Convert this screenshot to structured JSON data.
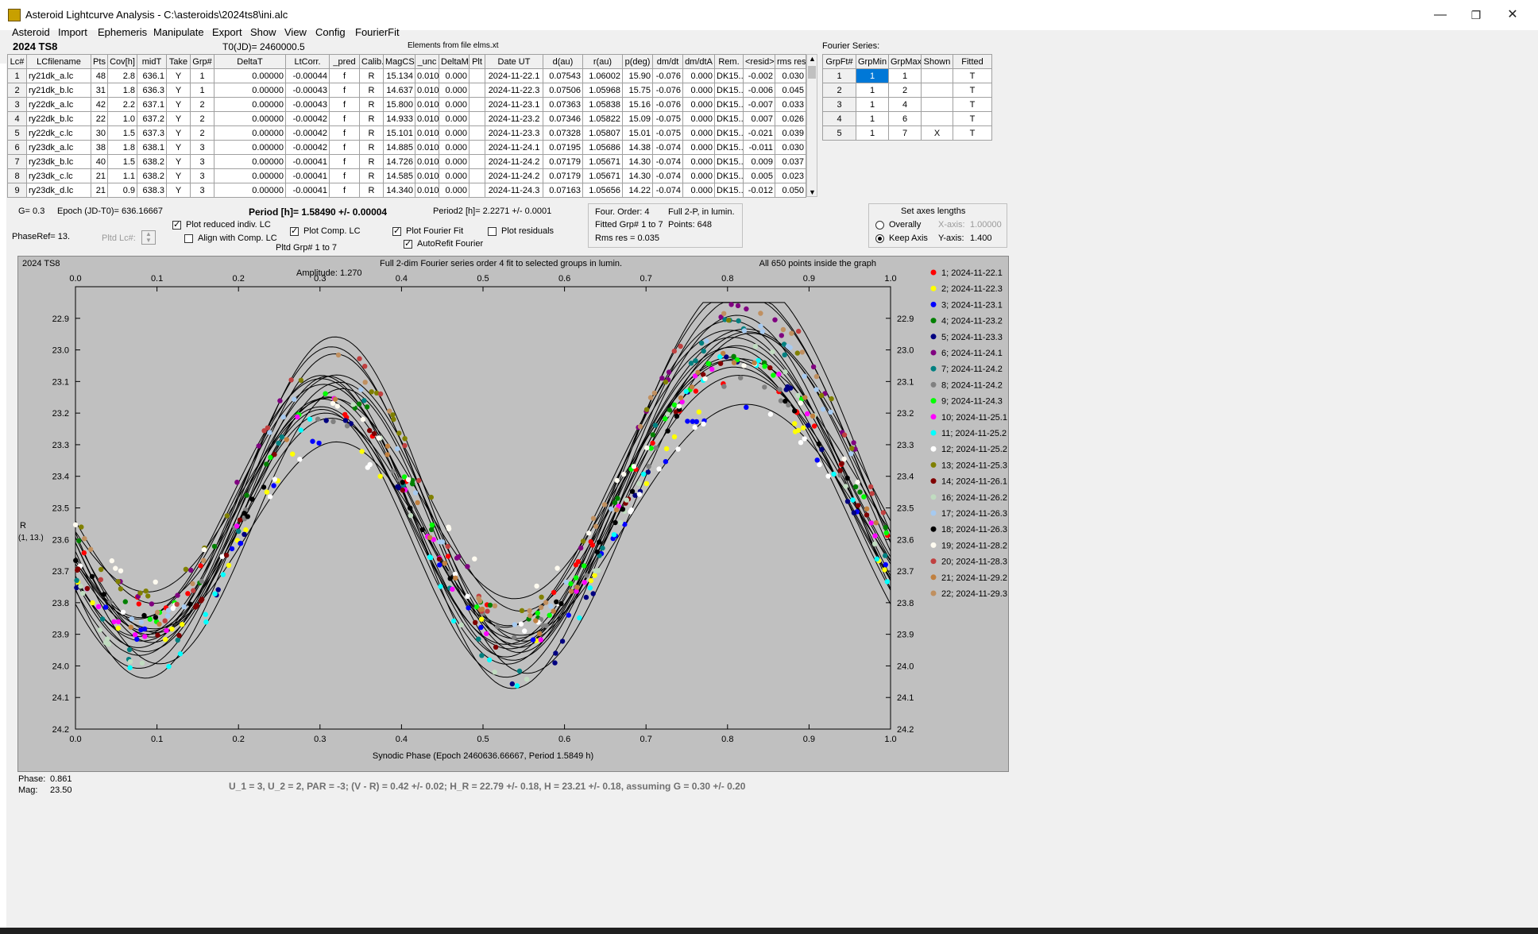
{
  "window": {
    "title": "Asteroid Lightcurve Analysis - C:\\asteroids\\2024ts8\\ini.alc"
  },
  "menu": [
    "Asteroid",
    "Import",
    "Ephemeris",
    "Manipulate",
    "Export",
    "Show",
    "View",
    "Config",
    "FourierFit"
  ],
  "header": {
    "object": "2024 TS8",
    "t0": "T0(JD)= 2460000.5",
    "elements": "Elements from file elms.xt",
    "fourier_label": "Fourier Series:"
  },
  "lc_table": {
    "columns": [
      "Lc#",
      "LCfilename",
      "Pts",
      "Cov[h]",
      "midT",
      "Take",
      "Grp#",
      "DeltaT",
      "LtCorr.",
      "_pred",
      "Calib.",
      "MagCS",
      "_unc",
      "DeltaM",
      "Plt",
      "Date UT",
      "d(au)",
      "r(au)",
      "p(deg)",
      "dm/dt",
      "dm/dtA",
      "Rem.",
      "<resid>",
      "rms res"
    ],
    "rows": [
      [
        "1",
        "ry21dk_a.lc",
        "48",
        "2.8",
        "636.1",
        "Y",
        "1",
        "0.00000",
        "-0.00044",
        "f",
        "R",
        "15.134",
        "0.010",
        "0.000",
        "",
        "2024-11-22.1",
        "0.07543",
        "1.06002",
        "15.90",
        "-0.076",
        "0.000",
        "DK15..",
        "-0.002",
        "0.030"
      ],
      [
        "2",
        "ry21dk_b.lc",
        "31",
        "1.8",
        "636.3",
        "Y",
        "1",
        "0.00000",
        "-0.00043",
        "f",
        "R",
        "14.637",
        "0.010",
        "0.000",
        "",
        "2024-11-22.3",
        "0.07506",
        "1.05968",
        "15.75",
        "-0.076",
        "0.000",
        "DK15..",
        "-0.006",
        "0.045"
      ],
      [
        "3",
        "ry22dk_a.lc",
        "42",
        "2.2",
        "637.1",
        "Y",
        "2",
        "0.00000",
        "-0.00043",
        "f",
        "R",
        "15.800",
        "0.010",
        "0.000",
        "",
        "2024-11-23.1",
        "0.07363",
        "1.05838",
        "15.16",
        "-0.076",
        "0.000",
        "DK15..",
        "-0.007",
        "0.033"
      ],
      [
        "4",
        "ry22dk_b.lc",
        "22",
        "1.0",
        "637.2",
        "Y",
        "2",
        "0.00000",
        "-0.00042",
        "f",
        "R",
        "14.933",
        "0.010",
        "0.000",
        "",
        "2024-11-23.2",
        "0.07346",
        "1.05822",
        "15.09",
        "-0.075",
        "0.000",
        "DK15..",
        "0.007",
        "0.026"
      ],
      [
        "5",
        "ry22dk_c.lc",
        "30",
        "1.5",
        "637.3",
        "Y",
        "2",
        "0.00000",
        "-0.00042",
        "f",
        "R",
        "15.101",
        "0.010",
        "0.000",
        "",
        "2024-11-23.3",
        "0.07328",
        "1.05807",
        "15.01",
        "-0.075",
        "0.000",
        "DK15..",
        "-0.021",
        "0.039"
      ],
      [
        "6",
        "ry23dk_a.lc",
        "38",
        "1.8",
        "638.1",
        "Y",
        "3",
        "0.00000",
        "-0.00042",
        "f",
        "R",
        "14.885",
        "0.010",
        "0.000",
        "",
        "2024-11-24.1",
        "0.07195",
        "1.05686",
        "14.38",
        "-0.074",
        "0.000",
        "DK15..",
        "-0.011",
        "0.030"
      ],
      [
        "7",
        "ry23dk_b.lc",
        "40",
        "1.5",
        "638.2",
        "Y",
        "3",
        "0.00000",
        "-0.00041",
        "f",
        "R",
        "14.726",
        "0.010",
        "0.000",
        "",
        "2024-11-24.2",
        "0.07179",
        "1.05671",
        "14.30",
        "-0.074",
        "0.000",
        "DK15..",
        "0.009",
        "0.037"
      ],
      [
        "8",
        "ry23dk_c.lc",
        "21",
        "1.1",
        "638.2",
        "Y",
        "3",
        "0.00000",
        "-0.00041",
        "f",
        "R",
        "14.585",
        "0.010",
        "0.000",
        "",
        "2024-11-24.2",
        "0.07179",
        "1.05671",
        "14.30",
        "-0.074",
        "0.000",
        "DK15..",
        "0.005",
        "0.023"
      ],
      [
        "9",
        "ry23dk_d.lc",
        "21",
        "0.9",
        "638.3",
        "Y",
        "3",
        "0.00000",
        "-0.00041",
        "f",
        "R",
        "14.340",
        "0.010",
        "0.000",
        "",
        "2024-11-24.3",
        "0.07163",
        "1.05656",
        "14.22",
        "-0.074",
        "0.000",
        "DK15..",
        "-0.012",
        "0.050"
      ]
    ]
  },
  "fourier_table": {
    "columns": [
      "GrpFt#",
      "GrpMin",
      "GrpMax",
      "Shown",
      "Fitted"
    ],
    "rows": [
      [
        "1",
        "1",
        "1",
        "",
        "T"
      ],
      [
        "2",
        "1",
        "2",
        "",
        "T"
      ],
      [
        "3",
        "1",
        "4",
        "",
        "T"
      ],
      [
        "4",
        "1",
        "6",
        "",
        "T"
      ],
      [
        "5",
        "1",
        "7",
        "X",
        "T"
      ]
    ]
  },
  "params": {
    "g": "G= 0.3",
    "epoch": "Epoch (JD-T0)= 636.16667",
    "period": "Period [h]= 1.58490 +/- 0.00004",
    "period2": "Period2 [h]= 2.2271 +/- 0.0001",
    "phaseref": "PhaseRef= 13.",
    "pltd_lc": "Pltd Lc#:",
    "pltd_grp": "Pltd Grp#  1  to  7"
  },
  "checks": [
    {
      "label": "Plot reduced indiv. LC",
      "on": true
    },
    {
      "label": "Align with Comp. LC",
      "on": false
    },
    {
      "label": "Plot Comp. LC",
      "on": true
    },
    {
      "label": "Plot Fourier Fit",
      "on": true
    },
    {
      "label": "AutoRefit Fourier",
      "on": true
    },
    {
      "label": "Plot residuals",
      "on": false
    }
  ],
  "fit_info": {
    "l1": "Four. Order:  4",
    "l1b": "Full 2-P, in lumin.",
    "l2": "Fitted Grp# 1 to 7",
    "l2b": "Points: 648",
    "l3": "Rms res     = 0.035"
  },
  "axes": {
    "title": "Set axes lengths",
    "overally": "Overally",
    "keep": "Keep Axis",
    "xaxis_label": "X-axis:",
    "xaxis_val": "1.00000",
    "yaxis_label": "Y-axis:",
    "yaxis_val": "1.400"
  },
  "plot": {
    "obj": "2024 TS8",
    "desc": "Full 2-dim Fourier series order 4 fit to selected groups in lumin.",
    "amp": "Amplitude: 1.270",
    "allpts": "All 650 points inside the graph",
    "ylabel": "R",
    "ylabel2": "(1, 13.)",
    "xlabel": "Synodic Phase (Epoch 2460636.66667, Period 1.5849 h)"
  },
  "chart_data": {
    "type": "scatter",
    "xlim": [
      0,
      1
    ],
    "ylim": [
      24.2,
      22.8
    ],
    "xticks": [
      "0.0",
      "0.1",
      "0.2",
      "0.3",
      "0.4",
      "0.5",
      "0.6",
      "0.7",
      "0.8",
      "0.9",
      "1.0"
    ],
    "yticks": [
      "22.9",
      "23.0",
      "23.1",
      "23.2",
      "23.3",
      "23.4",
      "23.5",
      "23.6",
      "23.7",
      "23.8",
      "23.9",
      "24.0",
      "24.1",
      "24.2"
    ],
    "series": [
      {
        "name": "1; 2024-11-22.1",
        "color": "#ff0000"
      },
      {
        "name": "2; 2024-11-22.3",
        "color": "#ffff00"
      },
      {
        "name": "3; 2024-11-23.1",
        "color": "#0000ff"
      },
      {
        "name": "4; 2024-11-23.2",
        "color": "#008000"
      },
      {
        "name": "5; 2024-11-23.3",
        "color": "#000080"
      },
      {
        "name": "6; 2024-11-24.1",
        "color": "#800080"
      },
      {
        "name": "7; 2024-11-24.2",
        "color": "#008080"
      },
      {
        "name": "8; 2024-11-24.2",
        "color": "#808080"
      },
      {
        "name": "9; 2024-11-24.3",
        "color": "#00ff00"
      },
      {
        "name": "10; 2024-11-25.1",
        "color": "#ff00ff"
      },
      {
        "name": "11; 2024-11-25.2",
        "color": "#00ffff"
      },
      {
        "name": "12; 2024-11-25.2",
        "color": "#ffffff"
      },
      {
        "name": "13; 2024-11-25.3",
        "color": "#808000"
      },
      {
        "name": "14; 2024-11-26.1",
        "color": "#800000"
      },
      {
        "name": "16; 2024-11-26.2",
        "color": "#c0dcc0"
      },
      {
        "name": "17; 2024-11-26.3",
        "color": "#a6caf0"
      },
      {
        "name": "18; 2024-11-26.3",
        "color": "#000000"
      },
      {
        "name": "19; 2024-11-28.2",
        "color": "#fffbf0"
      },
      {
        "name": "20; 2024-11-28.3",
        "color": "#c04040"
      },
      {
        "name": "21; 2024-11-29.2",
        "color": "#c08040"
      },
      {
        "name": "22; 2024-11-29.3",
        "color": "#c09060"
      }
    ]
  },
  "status": {
    "phase_label": "Phase:",
    "phase_val": "0.861",
    "mag_label": "Mag:",
    "mag_val": "23.50",
    "summary": "U_1 = 3, U_2 = 2, PAR = -3; (V - R) = 0.42 +/- 0.02; H_R = 22.79 +/- 0.18, H = 23.21 +/- 0.18, assuming G = 0.30 +/- 0.20"
  }
}
